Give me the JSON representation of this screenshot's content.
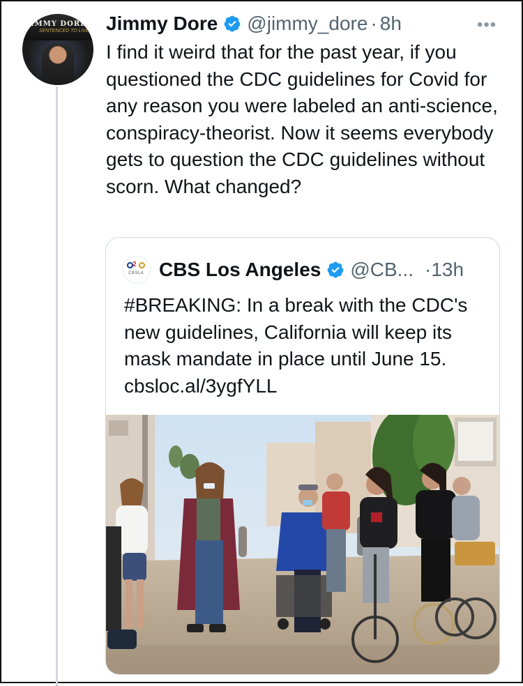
{
  "tweet": {
    "display_name": "Jimmy Dore",
    "handle": "@jimmy_dore",
    "separator": "·",
    "time": "8h",
    "more": "•••",
    "text": "I find it weird that for the past year, if you questioned the CDC guidelines for Covid for any reason you were labeled an anti-science, conspiracy-theorist. Now it seems everybody gets to question the CDC guidelines without scorn. What changed?",
    "avatar": {
      "line1": "IMMY DORE",
      "line2": "SENTENCED TO LIVE"
    }
  },
  "quoted": {
    "display_name": "CBS Los Angeles",
    "handle": "@CB...",
    "separator": "·",
    "time": "13h",
    "text": "#BREAKING: In a break with the CDC's new guidelines, California will keep its mask mandate in place until June 15. cbsloc.al/3ygfYLL",
    "logo": {
      "number": "2",
      "caption": "CBSLA"
    }
  },
  "icons": {
    "verified": "verified-badge-icon",
    "more": "more-options-icon"
  },
  "colors": {
    "verified_blue": "#1d9bf0",
    "secondary_text": "#536471",
    "thread_line": "#cfd9de"
  }
}
